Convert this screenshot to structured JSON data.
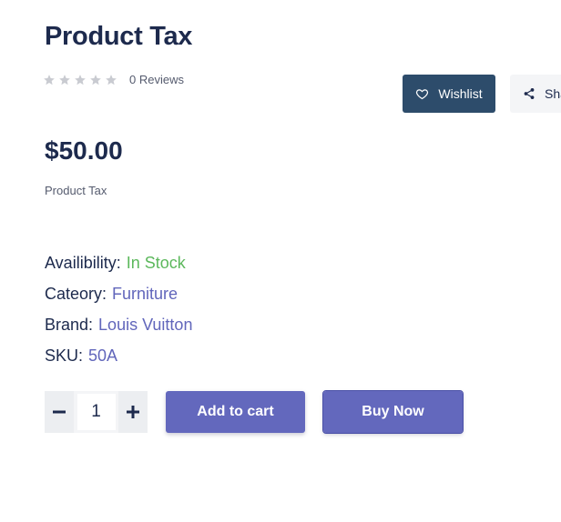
{
  "product": {
    "title": "Product Tax",
    "rating": {
      "value": 0,
      "max": 5,
      "reviews_label": "0 Reviews"
    },
    "price": "$50.00",
    "short_description": "Product Tax"
  },
  "actions": {
    "wishlist_label": "Wishlist",
    "share_label": "Share"
  },
  "meta": {
    "availability_label": "Availibility:",
    "availability_value": "In Stock",
    "category_label": "Cateory:",
    "category_value": "Furniture",
    "brand_label": "Brand:",
    "brand_value": "Louis Vuitton",
    "sku_label": "SKU:",
    "sku_value": "50A"
  },
  "purchase": {
    "quantity": "1",
    "add_to_cart_label": "Add to cart",
    "buy_now_label": "Buy Now"
  },
  "colors": {
    "heading": "#1d2a4d",
    "wishlist_bg": "#2d4c6b",
    "button_bg": "#6368bd",
    "link": "#6166bb",
    "in_stock": "#5cb85c",
    "star_empty": "#c9cbd1"
  },
  "icons": {
    "star": "star-icon",
    "wishlist": "heart-icon",
    "share": "share-icon",
    "decrease": "minus-icon",
    "increase": "plus-icon"
  }
}
